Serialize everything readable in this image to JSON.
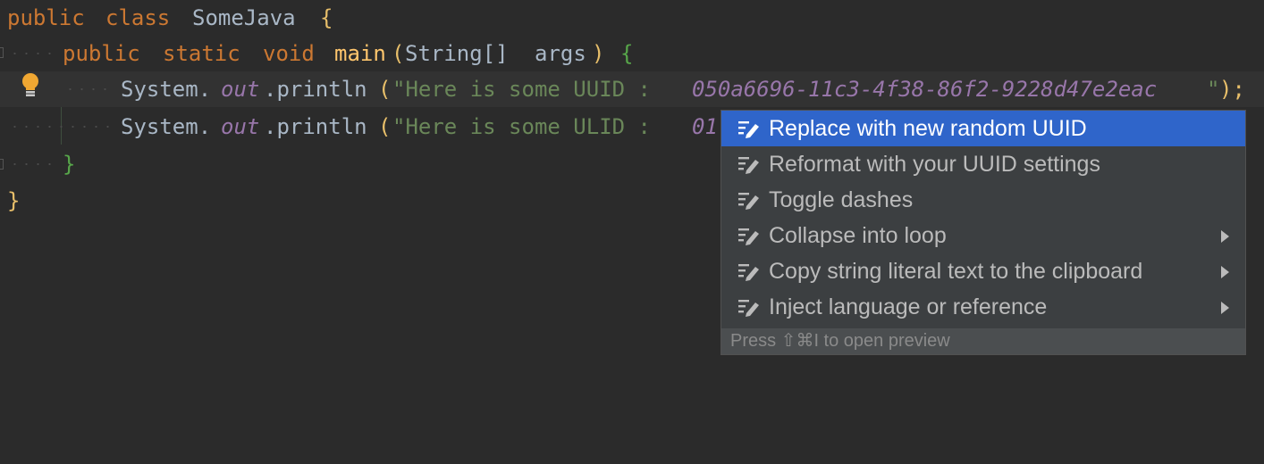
{
  "code": {
    "line1": {
      "kw_public": "public",
      "kw_class": "class",
      "class_name": "SomeJava",
      "brace": "{"
    },
    "line2": {
      "kw_public": "public",
      "kw_static": "static",
      "kw_void": "void",
      "method": "main",
      "paren_open": "(",
      "param_type": "String[]",
      "param_name": "args",
      "paren_close": ")",
      "brace": "{"
    },
    "line3": {
      "system": "System.",
      "out": "out",
      "println": ".println",
      "paren_open": "(",
      "str_prefix": "\"Here is some UUID : ",
      "uuid": "050a6696-11c3-4f38-86f2-9228d47e2eac",
      "str_suffix": "\"",
      "paren_close": ");"
    },
    "line4": {
      "system": "System.",
      "out": "out",
      "println": ".println",
      "paren_open": "(",
      "str_prefix": "\"Here is some ULID : ",
      "ulid_visible": "01"
    },
    "line5": {
      "brace": "}"
    },
    "line6": {
      "brace": "}"
    }
  },
  "gutter": {
    "intention_icon": "lightbulb-icon"
  },
  "popup": {
    "items": [
      {
        "label": "Replace with new random UUID",
        "icon": "edit-intention-icon",
        "submenu": false,
        "selected": true
      },
      {
        "label": "Reformat with your UUID settings",
        "icon": "edit-intention-icon",
        "submenu": false,
        "selected": false
      },
      {
        "label": "Toggle dashes",
        "icon": "edit-intention-icon",
        "submenu": false,
        "selected": false
      },
      {
        "label": "Collapse into loop",
        "icon": "edit-intention-icon",
        "submenu": true,
        "selected": false
      },
      {
        "label": "Copy string literal text to the clipboard",
        "icon": "edit-intention-icon",
        "submenu": true,
        "selected": false
      },
      {
        "label": "Inject language or reference",
        "icon": "edit-intention-icon",
        "submenu": true,
        "selected": false
      }
    ],
    "footer": "Press ⇧⌘I to open preview"
  },
  "colors": {
    "background": "#2b2b2b",
    "keyword": "#cc7832",
    "string": "#6a8759",
    "static_field": "#9876aa",
    "method": "#ffc66d",
    "popup_bg": "#3c3f41",
    "selection": "#2f65ca"
  }
}
